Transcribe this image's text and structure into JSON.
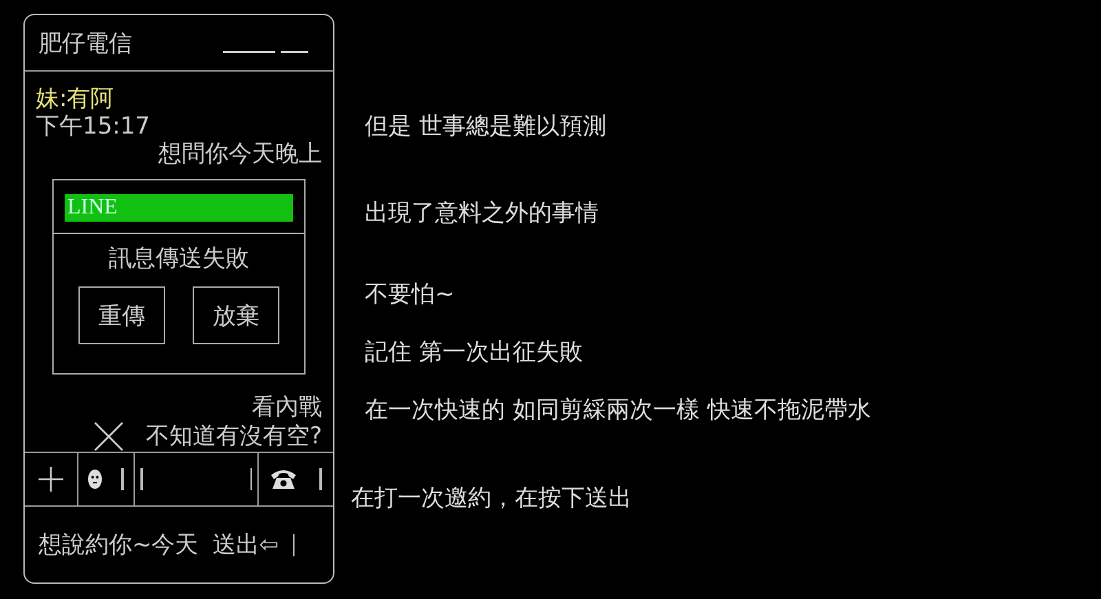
{
  "window": {
    "title": "肥仔電信"
  },
  "message": {
    "sender": "妹:有阿",
    "time": "下午15:17",
    "lines_before": [
      "想問你今天晚上"
    ],
    "lines_after": [
      "看內戰",
      "不知道有沒有空?"
    ]
  },
  "dialog": {
    "app": "LINE",
    "message": "訊息傳送失敗",
    "buttons": [
      "重傳",
      "放棄"
    ]
  },
  "input": {
    "value": "想說約你~今天",
    "send": "送出⇦"
  },
  "narration": [
    "但是 世事總是難以預測",
    "出現了意料之外的事情",
    "不要怕~",
    "記住 第一次出征失敗",
    "在一次快速的 如同剪綵兩次一樣 快速不拖泥帶水"
  ],
  "hint": "在打一次邀約，在按下送出"
}
